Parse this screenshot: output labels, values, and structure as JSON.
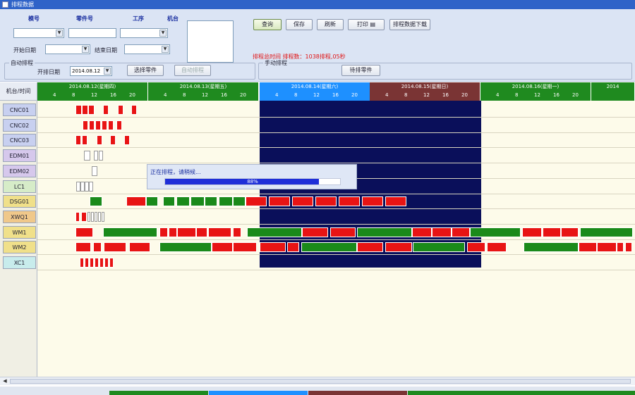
{
  "window": {
    "title": "排程数据"
  },
  "filters": {
    "label_model": "模号",
    "label_part": "零件号",
    "label_process": "工序",
    "label_machine": "机台",
    "label_start_date": "开始日期",
    "label_end_date": "结束日期"
  },
  "toolbar": {
    "query": "查询",
    "save": "保存",
    "refresh": "刷新",
    "print": "打印",
    "export": "排程数据下载"
  },
  "summary_text": "排程总时间  排程数：1038排程,05秒",
  "auto_schedule": {
    "title": "自动排程",
    "start_date_label": "开排日期",
    "start_date_value": "2014.08.12",
    "select_parts_button": "选择零件",
    "auto_button": "自动排程"
  },
  "manual_schedule": {
    "title": "手动排程",
    "pending_button": "待排零件"
  },
  "gantt": {
    "corner_label": "机台/时间",
    "days": [
      {
        "title": "2014.08.12(星期四)",
        "color": "#1f8a1f"
      },
      {
        "title": "2014.08.13(星期五)",
        "color": "#1f8a1f"
      },
      {
        "title": "2014.08.14(星期六)",
        "color": "#1e90ff"
      },
      {
        "title": "2014.08.15(星期日)",
        "color": "#7a3434"
      },
      {
        "title": "2014.08.16(星期一)",
        "color": "#1f8a1f"
      },
      {
        "title": "2014",
        "color": "#1f8a1f"
      }
    ],
    "hour_ticks": [
      "4",
      "8",
      "12",
      "16",
      "20"
    ],
    "rows": [
      {
        "label": "CNC01",
        "color": "#c8d0f0"
      },
      {
        "label": "CNC02",
        "color": "#c8d0f0"
      },
      {
        "label": "CNC03",
        "color": "#c8d0f0"
      },
      {
        "label": "EDM01",
        "color": "#d6c8ec"
      },
      {
        "label": "EDM02",
        "color": "#d6c8ec"
      },
      {
        "label": "LC1",
        "color": "#d6ecc8"
      },
      {
        "label": "DSG01",
        "color": "#f0e08a"
      },
      {
        "label": "XWQ1",
        "color": "#f0c88a"
      },
      {
        "label": "WM1",
        "color": "#f0e08a"
      },
      {
        "label": "WM2",
        "color": "#f0e08a"
      },
      {
        "label": "XC1",
        "color": "#c8ecec"
      }
    ]
  },
  "progress": {
    "message": "正在排程，请稍候...",
    "percent_label": "88%",
    "percent": 0.88
  }
}
